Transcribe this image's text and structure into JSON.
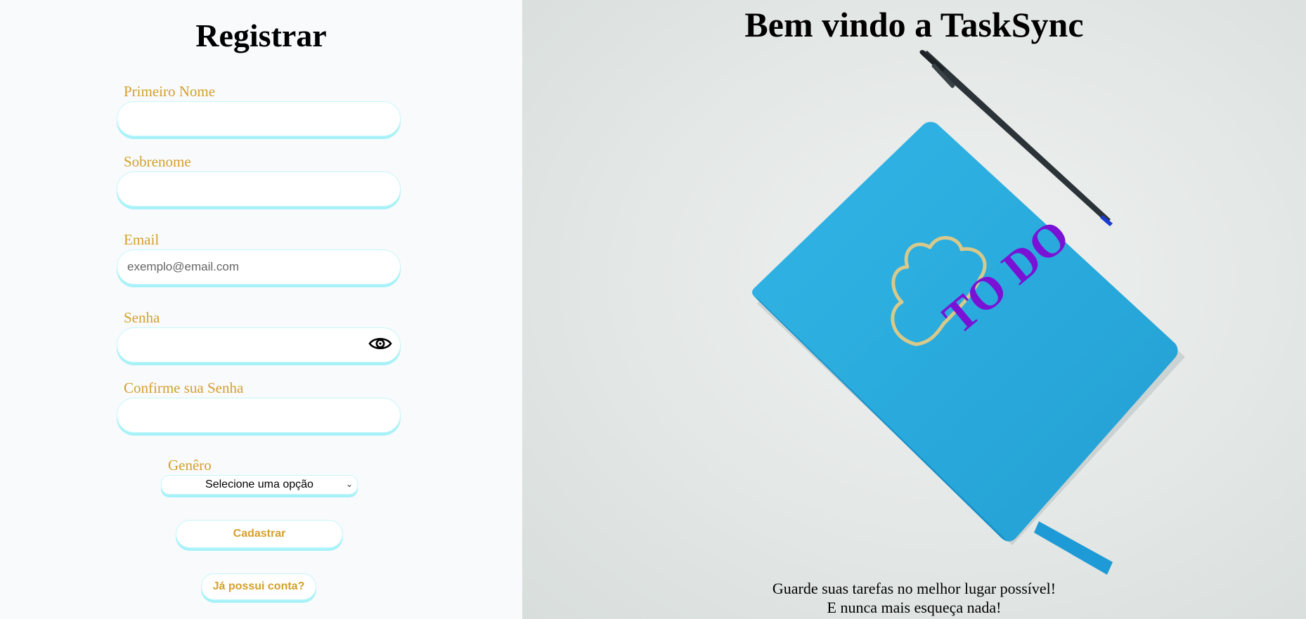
{
  "register": {
    "title": "Registrar",
    "first_name_label": "Primeiro Nome",
    "last_name_label": "Sobrenome",
    "email_label": "Email",
    "email_placeholder": "exemplo@email.com",
    "password_label": "Senha",
    "confirm_password_label": "Confirme sua Senha",
    "gender_label": "Genêro",
    "gender_selected": "Selecione uma opção",
    "submit_label": "Cadastrar",
    "login_link_label": "Já possui conta?"
  },
  "hero": {
    "title": "Bem vindo a TaskSync",
    "tagline_line1": "Guarde suas tarefas no melhor lugar possível!",
    "tagline_line2": "E nunca mais esqueça nada!",
    "notebook_text": "TO DO"
  },
  "colors": {
    "label": "#d4a02a",
    "input_border": "#a7f2f8",
    "notebook": "#2fb3e4",
    "notebook_text": "#7a12d6"
  },
  "icons": {
    "password_toggle": "eye-icon",
    "select_arrow": "chevron-down-icon"
  }
}
